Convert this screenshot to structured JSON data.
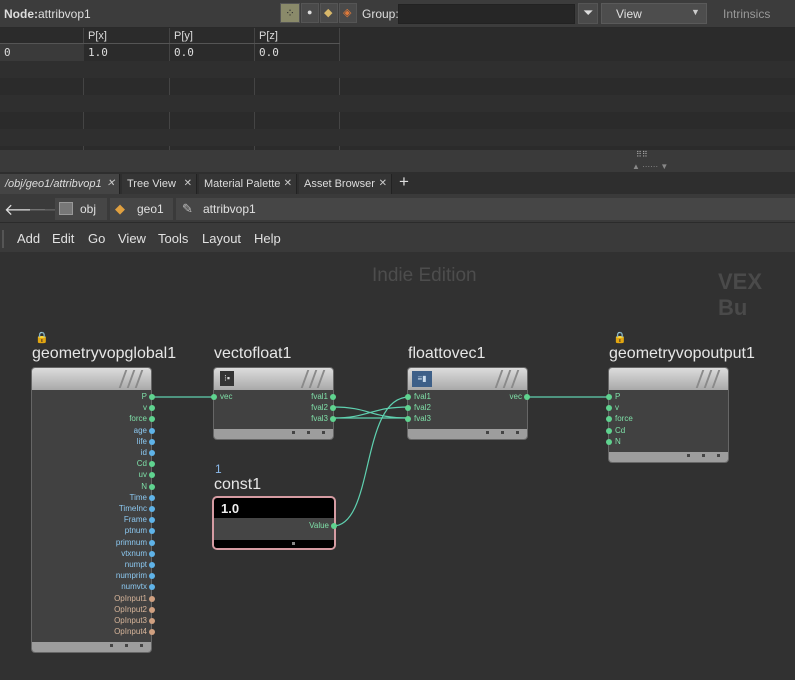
{
  "top": {
    "node_label": "Node:",
    "node_name": "attribvop1",
    "group_label": "Group:",
    "group_value": "",
    "view_label": "View",
    "intrinsics_label": "Intrinsics"
  },
  "sheet": {
    "columns": [
      "",
      "P[x]",
      "P[y]",
      "P[z]"
    ],
    "rows": [
      [
        "0",
        "1.0",
        "0.0",
        "0.0"
      ]
    ]
  },
  "tabs": [
    {
      "label": "/obj/geo1/attribvop1"
    },
    {
      "label": "Tree View"
    },
    {
      "label": "Material Palette"
    },
    {
      "label": "Asset Browser"
    }
  ],
  "path": {
    "items": [
      "obj",
      "geo1",
      "attribvop1"
    ]
  },
  "menu": [
    "Add",
    "Edit",
    "Go",
    "View",
    "Tools",
    "Layout",
    "Help"
  ],
  "network": {
    "watermark": "Indie Edition",
    "context_label": "VEX Bu",
    "nodes": {
      "global": {
        "name": "geometryvopglobal1",
        "outputs": [
          "P",
          "v",
          "force",
          "age",
          "life",
          "id",
          "Cd",
          "uv",
          "N",
          "Time",
          "TimeInc",
          "Frame",
          "ptnum",
          "primnum",
          "vtxnum",
          "numpt",
          "numprim",
          "numvtx",
          "OpInput1",
          "OpInput2",
          "OpInput3",
          "OpInput4"
        ]
      },
      "vectofloat": {
        "name": "vectofloat1",
        "inputs": [
          "vec"
        ],
        "outputs": [
          "fval1",
          "fval2",
          "fval3"
        ]
      },
      "floattovec": {
        "name": "floattovec1",
        "inputs": [
          "fval1",
          "fval2",
          "fval3"
        ],
        "outputs": [
          "vec"
        ]
      },
      "output": {
        "name": "geometryvopoutput1",
        "inputs": [
          "P",
          "v",
          "force",
          "Cd",
          "N"
        ]
      },
      "const": {
        "name": "const1",
        "badge": "1",
        "value": "1.0",
        "outputs": [
          "Value"
        ]
      }
    },
    "colors": {
      "wire": "#5fd1b0",
      "vec_port": "#5fd38f",
      "float_port": "#5fb3e8",
      "string_port": "#d0a080",
      "const_border": "#d69ca3"
    }
  }
}
